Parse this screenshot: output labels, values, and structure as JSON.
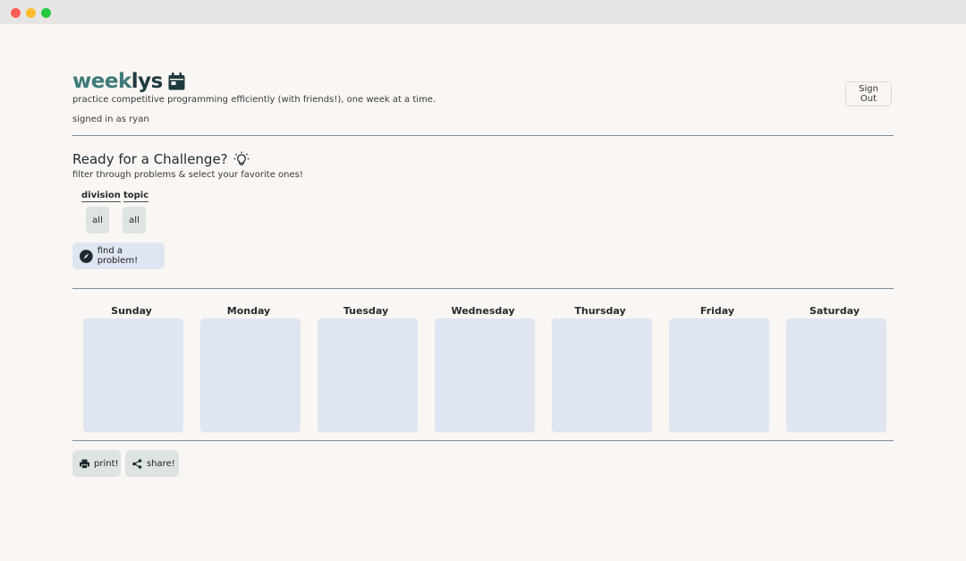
{
  "header": {
    "brand_part1": "week",
    "brand_part2": "lys",
    "brand_icon": "calendar-icon",
    "tagline": "practice competitive programming efficiently (with friends!), one week at a time.",
    "signed_in": "signed in as ryan",
    "sign_out_label": "Sign Out"
  },
  "challenge": {
    "title": "Ready for a Challenge?",
    "title_icon": "lightbulb-icon",
    "subtitle": "filter through problems & select your favorite ones!",
    "filters": [
      {
        "label": "division",
        "value": "all"
      },
      {
        "label": "topic",
        "value": "all"
      }
    ],
    "find_label": "find a problem!",
    "find_icon": "compass-icon"
  },
  "week": {
    "days": [
      "Sunday",
      "Monday",
      "Tuesday",
      "Wednesday",
      "Thursday",
      "Friday",
      "Saturday"
    ]
  },
  "actions": {
    "print_label": "print!",
    "print_icon": "printer-icon",
    "share_label": "share!",
    "share_icon": "share-icon"
  },
  "colors": {
    "background": "#f9f6f3",
    "brand_teal": "#3f7a7a",
    "brand_dark": "#1f3a3f",
    "day_box": "#dfe6f2",
    "filter_btn": "#dde4e2",
    "divider": "#7e8ea0"
  }
}
